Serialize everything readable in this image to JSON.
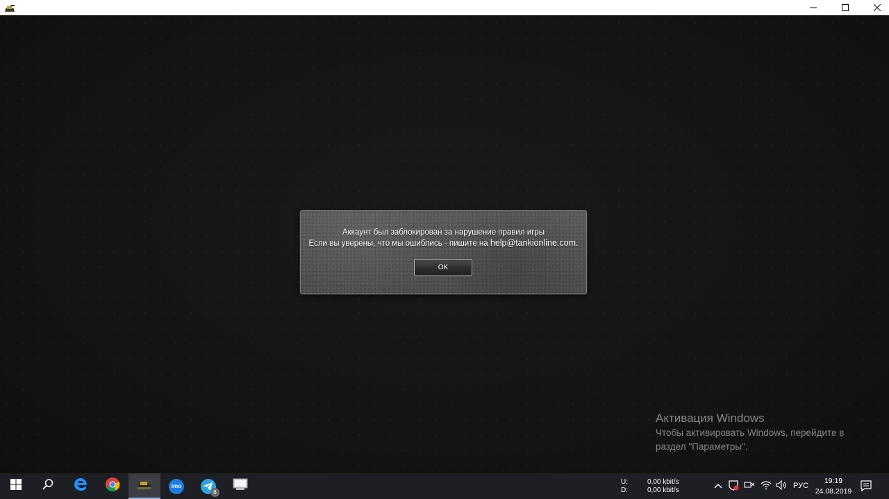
{
  "window": {
    "controls": {
      "minimize": "—",
      "maximize": "☐",
      "close": "✕"
    }
  },
  "dialog": {
    "line1": "Аккаунт был заблокирован за нарушение правил игры",
    "line2": "Если вы уверены, что мы ошиблись - пишите на",
    "email": "help@tankionline.com.",
    "ok_label": "OK"
  },
  "activation": {
    "title": "Активация Windows",
    "text": "Чтобы активировать Windows, перейдите в раздел \"Параметры\"."
  },
  "taskbar": {
    "pinned": [
      "windows-start-icon",
      "search-icon",
      "edge-icon",
      "chrome-icon",
      "tanki-online-icon",
      "imo-icon",
      "telegram-icon",
      "app-window-icon"
    ],
    "telegram_badge": "6",
    "imo_label": "imo",
    "network": {
      "upload_label": "U:",
      "upload_value": "0,00 kbit/s",
      "download_label": "D:",
      "download_value": "0,00 kbit/s"
    },
    "language": "РУС",
    "time": "19:19",
    "date": "24.08.2019"
  },
  "colors": {
    "background": "#151412",
    "taskbar": "#1d1f24",
    "dialog": "#555553",
    "accent": "#8fb4e6"
  }
}
